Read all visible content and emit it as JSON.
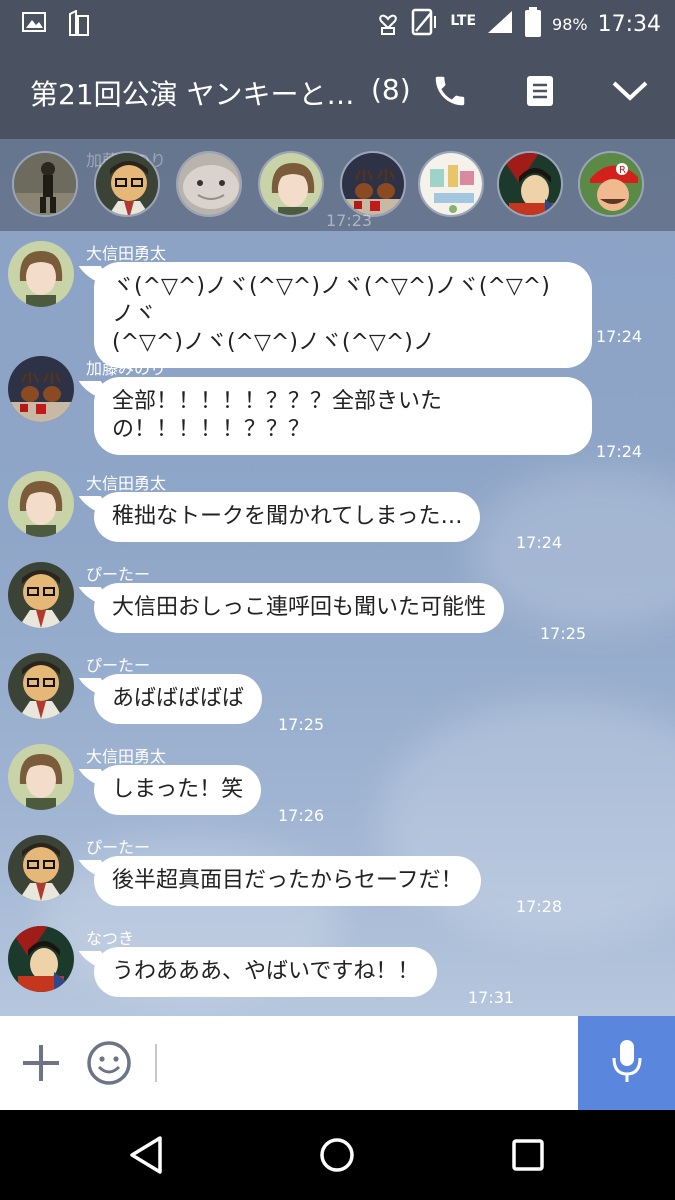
{
  "status_bar": {
    "network": "LTE",
    "battery_percent": "98%",
    "time": "17:34",
    "icons": [
      "gallery-icon",
      "sim-icon",
      "heart-notification-icon",
      "vibrate-icon",
      "signal-icon",
      "battery-icon"
    ]
  },
  "header": {
    "title": "第21回公演 ヤンキーと…",
    "member_count": "(8)",
    "icons": [
      "phone-icon",
      "notes-icon",
      "chevron-down-icon"
    ]
  },
  "member_strip": {
    "ghost_text": "加藤みのり",
    "ghost_time": "17:23",
    "avatar_count": 8
  },
  "messages": [
    {
      "sender": "大信田勇太",
      "text": "ヾ(^▽^)ノヾ(^▽^)ノヾ(^▽^)ノヾ(^▽^)ノヾ\n(^▽^)ノヾ(^▽^)ノヾ(^▽^)ノ",
      "time": "17:24",
      "avatar": "short-hair-person"
    },
    {
      "sender": "加藤みのり",
      "text": "全部！！！！！？？？全部きいた\nの！！！！！？？？",
      "time": "17:24",
      "avatar": "reindeer"
    },
    {
      "sender": "大信田勇太",
      "text": "稚拙なトークを聞かれてしまった…",
      "time": "17:24",
      "avatar": "short-hair-person"
    },
    {
      "sender": "ぴーたー",
      "text": "大信田おしっこ連呼回も聞いた可能性",
      "time": "17:25",
      "avatar": "cartoon-man"
    },
    {
      "sender": "ぴーたー",
      "text": "あばばばばば",
      "time": "17:25",
      "avatar": "cartoon-man"
    },
    {
      "sender": "大信田勇太",
      "text": "しまった！笑",
      "time": "17:26",
      "avatar": "short-hair-person"
    },
    {
      "sender": "ぴーたー",
      "text": "後半超真面目だったからセーフだ！",
      "time": "17:28",
      "avatar": "cartoon-man"
    },
    {
      "sender": "なつき",
      "text": "うわあああ、やばいですね！！",
      "time": "17:31",
      "avatar": "painting"
    }
  ],
  "input_bar": {
    "placeholder": "",
    "icons": [
      "plus-icon",
      "emoji-icon",
      "microphone-icon"
    ]
  },
  "nav_bar": {
    "icons": [
      "back-icon",
      "home-icon",
      "recents-icon"
    ]
  },
  "colors": {
    "header_bg": "#4a5262",
    "chat_bg": "#8fa6c8",
    "mic_button": "#5b86de",
    "bubble": "#ffffff"
  }
}
